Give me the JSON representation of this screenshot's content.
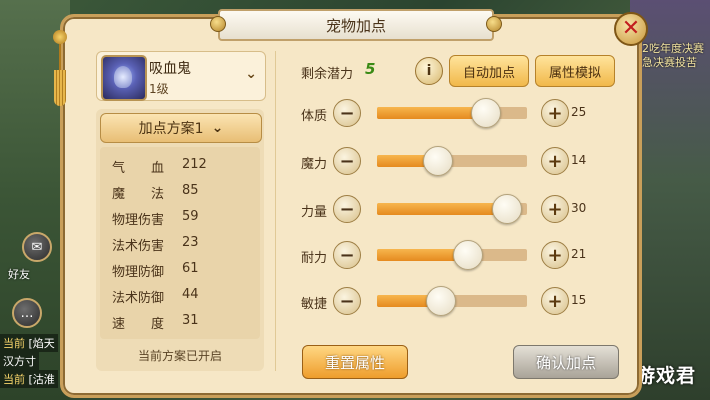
{
  "window": {
    "title": "宠物加点",
    "close_label": "✕"
  },
  "pet": {
    "name": "吸血鬼",
    "level": "1级",
    "avatar_icon": "vampire-pet-avatar",
    "dropdown_icon": "chevron-down"
  },
  "plan": {
    "label": "加点方案1",
    "chevron": "⌄",
    "note": "当前方案已开启"
  },
  "stats": [
    {
      "label": "气　　血",
      "value": "212"
    },
    {
      "label": "魔　　法",
      "value": "85"
    },
    {
      "label": "物理伤害",
      "value": "59"
    },
    {
      "label": "法术伤害",
      "value": "23"
    },
    {
      "label": "物理防御",
      "value": "61"
    },
    {
      "label": "法术防御",
      "value": "44"
    },
    {
      "label": "速　　度",
      "value": "31"
    }
  ],
  "potential": {
    "label": "剩余潜力",
    "value": "5"
  },
  "buttons": {
    "info": "i",
    "auto": "自动加点",
    "simulate": "属性模拟",
    "reset": "重置属性",
    "confirm": "确认加点",
    "minus": "−",
    "plus": "+"
  },
  "attributes": [
    {
      "name": "体质",
      "points": "25",
      "fill": 0.72
    },
    {
      "name": "魔力",
      "points": "14",
      "fill": 0.4
    },
    {
      "name": "力量",
      "points": "30",
      "fill": 0.86
    },
    {
      "name": "耐力",
      "points": "21",
      "fill": 0.6
    },
    {
      "name": "敏捷",
      "points": "15",
      "fill": 0.42
    }
  ],
  "background": {
    "top_right_text": "2吃年度决赛",
    "top_right_text2": "急决赛投苦",
    "chat": [
      {
        "tag": "当前",
        "text": "[焰天"
      },
      {
        "tag": "",
        "text": "汉方寸"
      },
      {
        "tag": "当前",
        "text": "[沽淮"
      }
    ],
    "friend_label": "好友",
    "watermark": "梦幻游戏君"
  },
  "colors": {
    "accent": "#f1b84a",
    "panel": "#f6e7c6",
    "potential_value": "#3a8a15",
    "close_x": "#c21f1f"
  }
}
